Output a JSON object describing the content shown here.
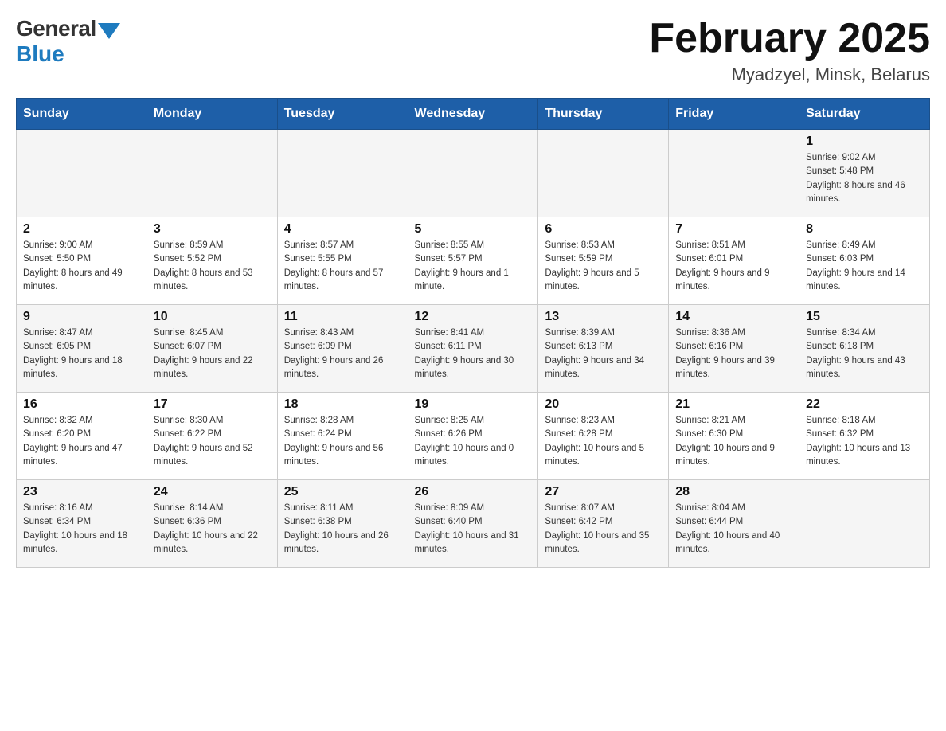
{
  "header": {
    "logo": {
      "general": "General",
      "blue": "Blue"
    },
    "title": "February 2025",
    "subtitle": "Myadzyel, Minsk, Belarus"
  },
  "weekdays": [
    "Sunday",
    "Monday",
    "Tuesday",
    "Wednesday",
    "Thursday",
    "Friday",
    "Saturday"
  ],
  "weeks": [
    [
      {
        "day": "",
        "info": ""
      },
      {
        "day": "",
        "info": ""
      },
      {
        "day": "",
        "info": ""
      },
      {
        "day": "",
        "info": ""
      },
      {
        "day": "",
        "info": ""
      },
      {
        "day": "",
        "info": ""
      },
      {
        "day": "1",
        "info": "Sunrise: 9:02 AM\nSunset: 5:48 PM\nDaylight: 8 hours and 46 minutes."
      }
    ],
    [
      {
        "day": "2",
        "info": "Sunrise: 9:00 AM\nSunset: 5:50 PM\nDaylight: 8 hours and 49 minutes."
      },
      {
        "day": "3",
        "info": "Sunrise: 8:59 AM\nSunset: 5:52 PM\nDaylight: 8 hours and 53 minutes."
      },
      {
        "day": "4",
        "info": "Sunrise: 8:57 AM\nSunset: 5:55 PM\nDaylight: 8 hours and 57 minutes."
      },
      {
        "day": "5",
        "info": "Sunrise: 8:55 AM\nSunset: 5:57 PM\nDaylight: 9 hours and 1 minute."
      },
      {
        "day": "6",
        "info": "Sunrise: 8:53 AM\nSunset: 5:59 PM\nDaylight: 9 hours and 5 minutes."
      },
      {
        "day": "7",
        "info": "Sunrise: 8:51 AM\nSunset: 6:01 PM\nDaylight: 9 hours and 9 minutes."
      },
      {
        "day": "8",
        "info": "Sunrise: 8:49 AM\nSunset: 6:03 PM\nDaylight: 9 hours and 14 minutes."
      }
    ],
    [
      {
        "day": "9",
        "info": "Sunrise: 8:47 AM\nSunset: 6:05 PM\nDaylight: 9 hours and 18 minutes."
      },
      {
        "day": "10",
        "info": "Sunrise: 8:45 AM\nSunset: 6:07 PM\nDaylight: 9 hours and 22 minutes."
      },
      {
        "day": "11",
        "info": "Sunrise: 8:43 AM\nSunset: 6:09 PM\nDaylight: 9 hours and 26 minutes."
      },
      {
        "day": "12",
        "info": "Sunrise: 8:41 AM\nSunset: 6:11 PM\nDaylight: 9 hours and 30 minutes."
      },
      {
        "day": "13",
        "info": "Sunrise: 8:39 AM\nSunset: 6:13 PM\nDaylight: 9 hours and 34 minutes."
      },
      {
        "day": "14",
        "info": "Sunrise: 8:36 AM\nSunset: 6:16 PM\nDaylight: 9 hours and 39 minutes."
      },
      {
        "day": "15",
        "info": "Sunrise: 8:34 AM\nSunset: 6:18 PM\nDaylight: 9 hours and 43 minutes."
      }
    ],
    [
      {
        "day": "16",
        "info": "Sunrise: 8:32 AM\nSunset: 6:20 PM\nDaylight: 9 hours and 47 minutes."
      },
      {
        "day": "17",
        "info": "Sunrise: 8:30 AM\nSunset: 6:22 PM\nDaylight: 9 hours and 52 minutes."
      },
      {
        "day": "18",
        "info": "Sunrise: 8:28 AM\nSunset: 6:24 PM\nDaylight: 9 hours and 56 minutes."
      },
      {
        "day": "19",
        "info": "Sunrise: 8:25 AM\nSunset: 6:26 PM\nDaylight: 10 hours and 0 minutes."
      },
      {
        "day": "20",
        "info": "Sunrise: 8:23 AM\nSunset: 6:28 PM\nDaylight: 10 hours and 5 minutes."
      },
      {
        "day": "21",
        "info": "Sunrise: 8:21 AM\nSunset: 6:30 PM\nDaylight: 10 hours and 9 minutes."
      },
      {
        "day": "22",
        "info": "Sunrise: 8:18 AM\nSunset: 6:32 PM\nDaylight: 10 hours and 13 minutes."
      }
    ],
    [
      {
        "day": "23",
        "info": "Sunrise: 8:16 AM\nSunset: 6:34 PM\nDaylight: 10 hours and 18 minutes."
      },
      {
        "day": "24",
        "info": "Sunrise: 8:14 AM\nSunset: 6:36 PM\nDaylight: 10 hours and 22 minutes."
      },
      {
        "day": "25",
        "info": "Sunrise: 8:11 AM\nSunset: 6:38 PM\nDaylight: 10 hours and 26 minutes."
      },
      {
        "day": "26",
        "info": "Sunrise: 8:09 AM\nSunset: 6:40 PM\nDaylight: 10 hours and 31 minutes."
      },
      {
        "day": "27",
        "info": "Sunrise: 8:07 AM\nSunset: 6:42 PM\nDaylight: 10 hours and 35 minutes."
      },
      {
        "day": "28",
        "info": "Sunrise: 8:04 AM\nSunset: 6:44 PM\nDaylight: 10 hours and 40 minutes."
      },
      {
        "day": "",
        "info": ""
      }
    ]
  ]
}
